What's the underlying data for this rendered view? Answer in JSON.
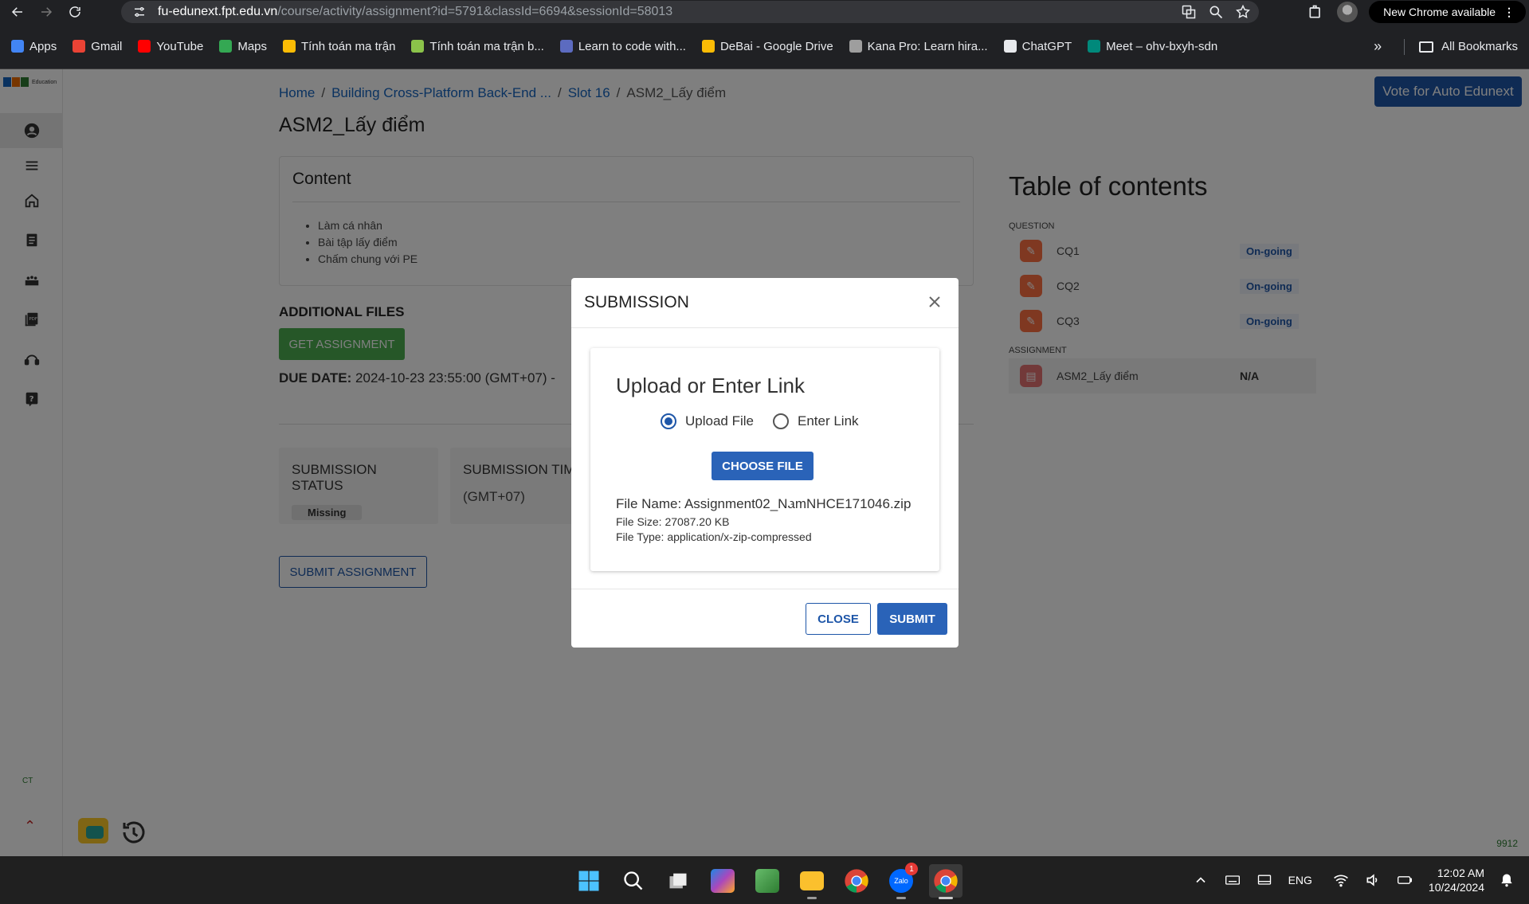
{
  "browser": {
    "url_domain": "fu-edunext.fpt.edu.vn",
    "url_path": "/course/activity/assignment?id=5791&classId=6694&sessionId=58013",
    "new_chrome": "New Chrome available",
    "bookmarks": [
      {
        "label": "Apps",
        "color": "#4285f4"
      },
      {
        "label": "Gmail",
        "color": "#ea4335"
      },
      {
        "label": "YouTube",
        "color": "#ff0000"
      },
      {
        "label": "Maps",
        "color": "#34a853"
      },
      {
        "label": "Tính toán ma trận",
        "color": "#fbbc05"
      },
      {
        "label": "Tính toán ma trận b...",
        "color": "#8bc34a"
      },
      {
        "label": "Learn to code with...",
        "color": "#5c6bc0"
      },
      {
        "label": "DeBai - Google Drive",
        "color": "#fbbc05"
      },
      {
        "label": "Kana Pro: Learn hira...",
        "color": "#9e9e9e"
      },
      {
        "label": "ChatGPT",
        "color": "#e8eaed"
      },
      {
        "label": "Meet – ohv-bxyh-sdn",
        "color": "#00897b"
      }
    ],
    "all_bookmarks": "All Bookmarks"
  },
  "page": {
    "breadcrumb": [
      "Home",
      "Building Cross-Platform Back-End ...",
      "Slot 16"
    ],
    "breadcrumb_current": "ASM2_Lấy điểm",
    "title": "ASM2_Lấy điểm",
    "vote_button": "Vote for Auto Edunext",
    "content_heading": "Content",
    "content_items": [
      "Làm cá nhân",
      "Bài tập lấy điểm",
      "Chấm chung với PE"
    ],
    "additional_files": "ADDITIONAL FILES",
    "get_assignment": "GET ASSIGNMENT",
    "due_label": "DUE DATE:",
    "due_value": "2024-10-23 23:55:00 (GMT+07) -",
    "submission_status_label": "SUBMISSION STATUS",
    "submission_status_value": "Missing",
    "submission_time_label": "SUBMISSION TIM",
    "submission_time_value": "(GMT+07)",
    "submit_assignment": "SUBMIT ASSIGNMENT",
    "sidebar_ct": "CT",
    "corner_number": "9912"
  },
  "toc": {
    "title": "Table of contents",
    "question_label": "QUESTION",
    "questions": [
      {
        "name": "CQ1",
        "status": "On-going"
      },
      {
        "name": "CQ2",
        "status": "On-going"
      },
      {
        "name": "CQ3",
        "status": "On-going"
      }
    ],
    "assignment_label": "ASSIGNMENT",
    "assignment": {
      "name": "ASM2_Lấy điểm",
      "score": "N/A"
    }
  },
  "modal": {
    "title": "SUBMISSION",
    "heading": "Upload or Enter Link",
    "option_upload": "Upload File",
    "option_link": "Enter Link",
    "selected_option": "Upload File",
    "choose_file": "CHOOSE FILE",
    "file_name": "File Name: Assignment02_NamNHCE171046.zip",
    "file_size": "File Size: 27087.20 KB",
    "file_type": "File Type: application/x-zip-compressed",
    "close": "CLOSE",
    "submit": "SUBMIT"
  },
  "taskbar": {
    "lang": "ENG",
    "time": "12:02 AM",
    "date": "10/24/2024",
    "zalo_badge": "1",
    "zalo_label": "Zalo"
  },
  "colors": {
    "primary": "#1e56a8",
    "success": "#4caf50",
    "overlay": "rgba(0,0,0,0.5)"
  }
}
